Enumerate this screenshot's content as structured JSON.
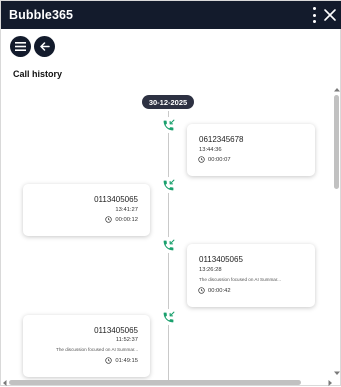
{
  "app": {
    "title": "Bubble365"
  },
  "page": {
    "heading": "Call history"
  },
  "timeline": {
    "date": "30-12-2025",
    "calls": [
      {
        "number": "0612345678",
        "time": "13:44:36",
        "summary": "",
        "duration": "00:00:07"
      },
      {
        "number": "0113405065",
        "time": "13:41:27",
        "summary": "",
        "duration": "00:00:12"
      },
      {
        "number": "0113405065",
        "time": "13:26:28",
        "summary": "The discussion focused on AI Summar...",
        "duration": "00:00:42"
      },
      {
        "number": "0113405065",
        "time": "11:52:37",
        "summary": "The discussion focused on AI Summar...",
        "duration": "01:49:15"
      }
    ]
  },
  "colors": {
    "titlebar": "#131b2c",
    "call_icon": "#1aa06d",
    "date_pill": "#2d3142"
  },
  "icons": {
    "menu": "hamburger-icon",
    "back": "arrow-left-icon",
    "more": "vertical-dots-icon",
    "close": "close-icon",
    "call": "incoming-call-icon",
    "duration": "clock-icon"
  }
}
